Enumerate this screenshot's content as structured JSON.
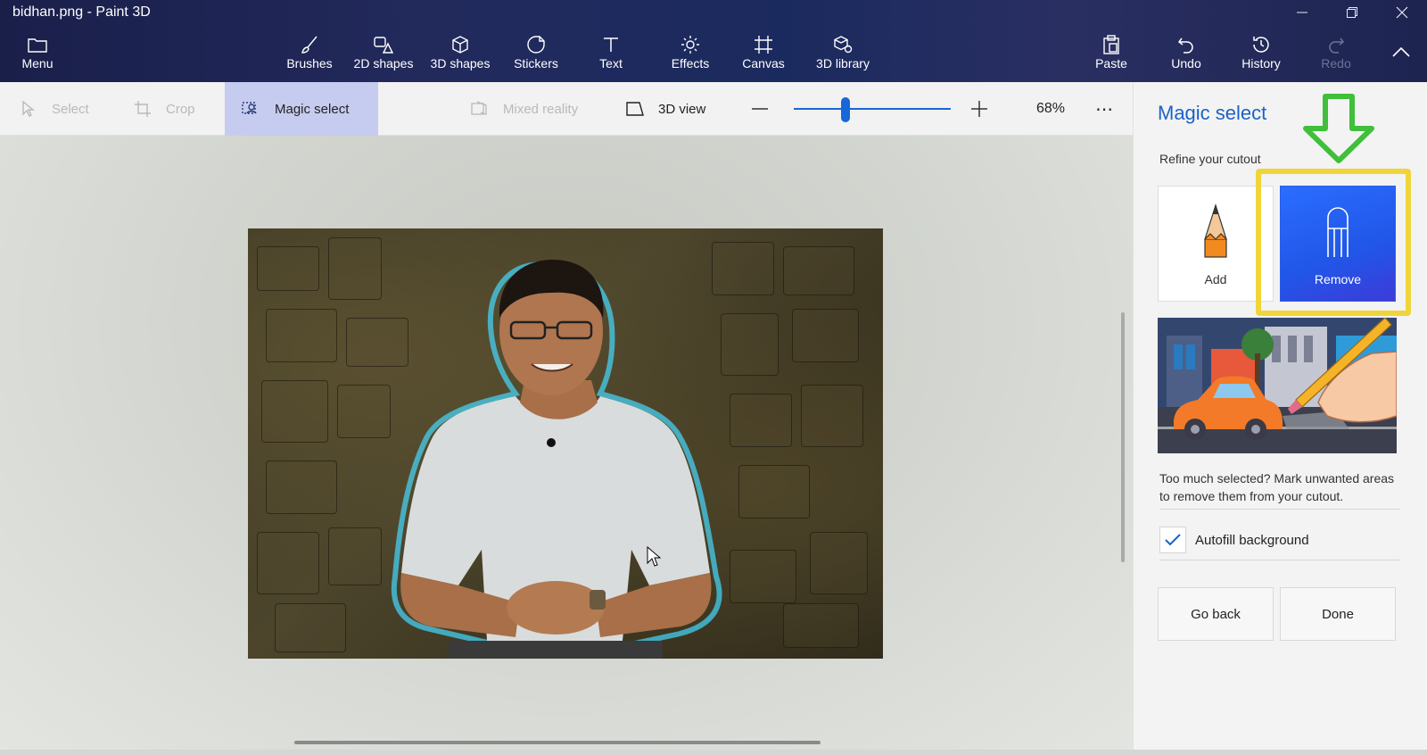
{
  "window": {
    "title": "bidhan.png - Paint 3D",
    "controls": [
      "minimize-icon",
      "restore-icon",
      "close-icon"
    ]
  },
  "ribbon": {
    "menu_label": "Menu",
    "tools": [
      {
        "label": "Brushes",
        "icon": "brush-icon"
      },
      {
        "label": "2D shapes",
        "icon": "2d-shapes-icon"
      },
      {
        "label": "3D shapes",
        "icon": "3d-shapes-icon"
      },
      {
        "label": "Stickers",
        "icon": "stickers-icon"
      },
      {
        "label": "Text",
        "icon": "text-icon"
      },
      {
        "label": "Effects",
        "icon": "effects-icon"
      },
      {
        "label": "Canvas",
        "icon": "canvas-icon"
      },
      {
        "label": "3D library",
        "icon": "3d-library-icon"
      }
    ],
    "paste_label": "Paste",
    "undo_label": "Undo",
    "history_label": "History",
    "redo_label": "Redo"
  },
  "toolbar": {
    "select_label": "Select",
    "crop_label": "Crop",
    "magic_select_label": "Magic select",
    "mixed_reality_label": "Mixed reality",
    "view_3d_label": "3D view",
    "zoom_level": "68%",
    "zoom_fraction": 0.33,
    "more_label": "⋯"
  },
  "panel": {
    "title": "Magic select",
    "subtitle": "Refine your cutout",
    "add_label": "Add",
    "remove_label": "Remove",
    "selected_mode": "Remove",
    "description": "Too much selected? Mark unwanted areas to remove them from your cutout.",
    "autofill_label": "Autofill background",
    "autofill_checked": true,
    "go_back_label": "Go back",
    "done_label": "Done"
  },
  "colors": {
    "accent": "#1a62c9",
    "selected_button": "#2a6dff",
    "annotation_box": "#f0d53a",
    "annotation_arrow": "#3fbf3a"
  }
}
